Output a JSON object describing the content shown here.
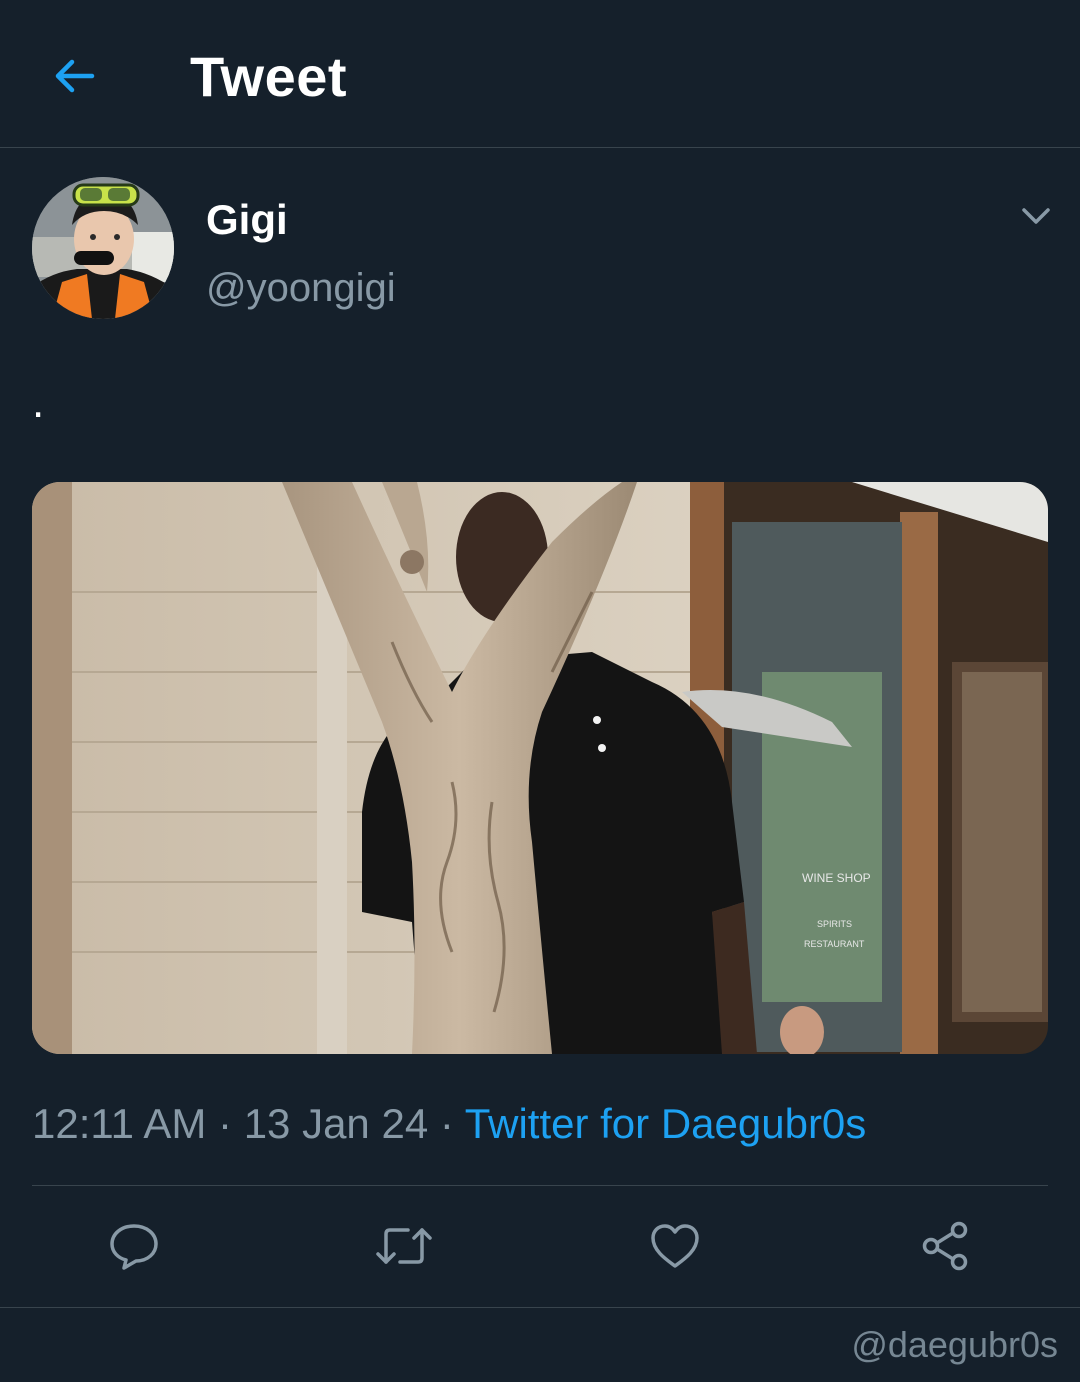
{
  "header": {
    "title": "Tweet",
    "back_icon": "arrow-left-icon"
  },
  "author": {
    "display_name": "Gigi",
    "handle": "@yoongigi",
    "avatar_icon": "avatar"
  },
  "tweet": {
    "text": ".",
    "time": "12:11 AM",
    "separator": "·",
    "date": "13 Jan 24",
    "source": "Twitter for Daegubr0s"
  },
  "media_signage": {
    "line1": "WINE SHOP",
    "line2": "SPIRITS",
    "line3": "RESTAURANT"
  },
  "actions": [
    "reply-icon",
    "retweet-icon",
    "like-icon",
    "share-icon"
  ],
  "watermark": "@daegubr0s",
  "colors": {
    "background": "#15202b",
    "accent": "#1da1f2",
    "secondary_text": "#8899a6",
    "border": "#38444d"
  }
}
